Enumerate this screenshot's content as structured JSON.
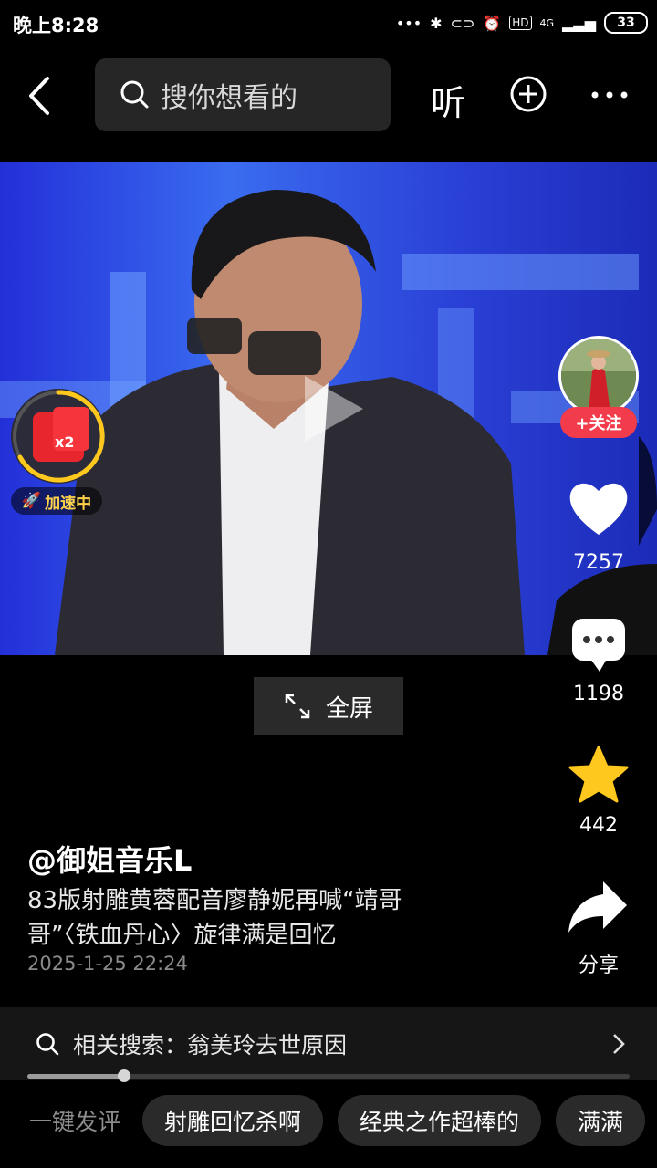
{
  "status_bar": {
    "time": "晚上8:28",
    "signal": "4G",
    "battery": "33"
  },
  "top_bar": {
    "search_placeholder": "搜你想看的",
    "listen_label": "听"
  },
  "speed_badge": {
    "multiplier": "x2",
    "label": "加速中"
  },
  "side": {
    "follow_label": "+关注",
    "likes": "7257",
    "comments": "1198",
    "favorites": "442",
    "share_label": "分享"
  },
  "fullscreen_label": "全屏",
  "post": {
    "author": "@御姐音乐L",
    "description": "83版射雕黄蓉配音廖静妮再喊“靖哥哥”〈铁血丹心〉旋律满是回忆",
    "date": "2025-1-25 22:24"
  },
  "related_search": "相关搜索：翁美玲去世原因",
  "playback_progress": 0.16,
  "quick_comment_label": "一键发评",
  "quick_comments": [
    "射雕回忆杀啊",
    "经典之作超棒的",
    "满满"
  ],
  "colors": {
    "follow": "#f23c4b",
    "like": "#ffffff",
    "favorite": "#ffc81e",
    "speed_ring": "#ffc81e"
  }
}
